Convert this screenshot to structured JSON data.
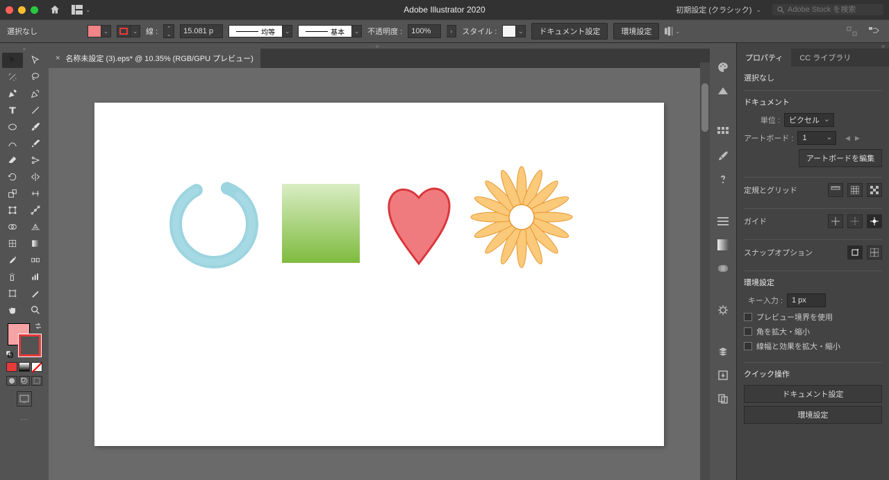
{
  "app_title": "Adobe Illustrator 2020",
  "workspace": "初期設定 (クラシック)",
  "search_placeholder": "Adobe Stock を検索",
  "selection_label": "選択なし",
  "stroke_label": "線 :",
  "stroke_weight": "15.081 p",
  "stroke_profile": "均等",
  "stroke_brush": "基本",
  "opacity_label": "不透明度 :",
  "opacity_value": "100%",
  "style_label": "スタイル :",
  "doc_setup_btn": "ドキュメント設定",
  "prefs_btn": "環境設定",
  "doc_tab": "名称未設定 (3).eps* @ 10.35% (RGB/GPU プレビュー)",
  "panel_tabs": {
    "properties": "プロパティ",
    "libraries": "CC ライブラリ"
  },
  "rp": {
    "no_selection": "選択なし",
    "document": "ドキュメント",
    "unit_label": "単位 :",
    "unit_value": "ピクセル",
    "artboard_label": "アートボード :",
    "artboard_value": "1",
    "edit_artboards": "アートボードを編集",
    "rulers_grid": "定規とグリッド",
    "guides": "ガイド",
    "snap": "スナップオプション",
    "prefs": "環境設定",
    "key_input_label": "キー入力 :",
    "key_input_value": "1 px",
    "chk1": "プレビュー境界を使用",
    "chk2": "角を拡大・縮小",
    "chk3": "線幅と効果を拡大・縮小",
    "quick": "クイック操作",
    "quick_doc": "ドキュメント設定",
    "quick_prefs": "環境設定"
  }
}
